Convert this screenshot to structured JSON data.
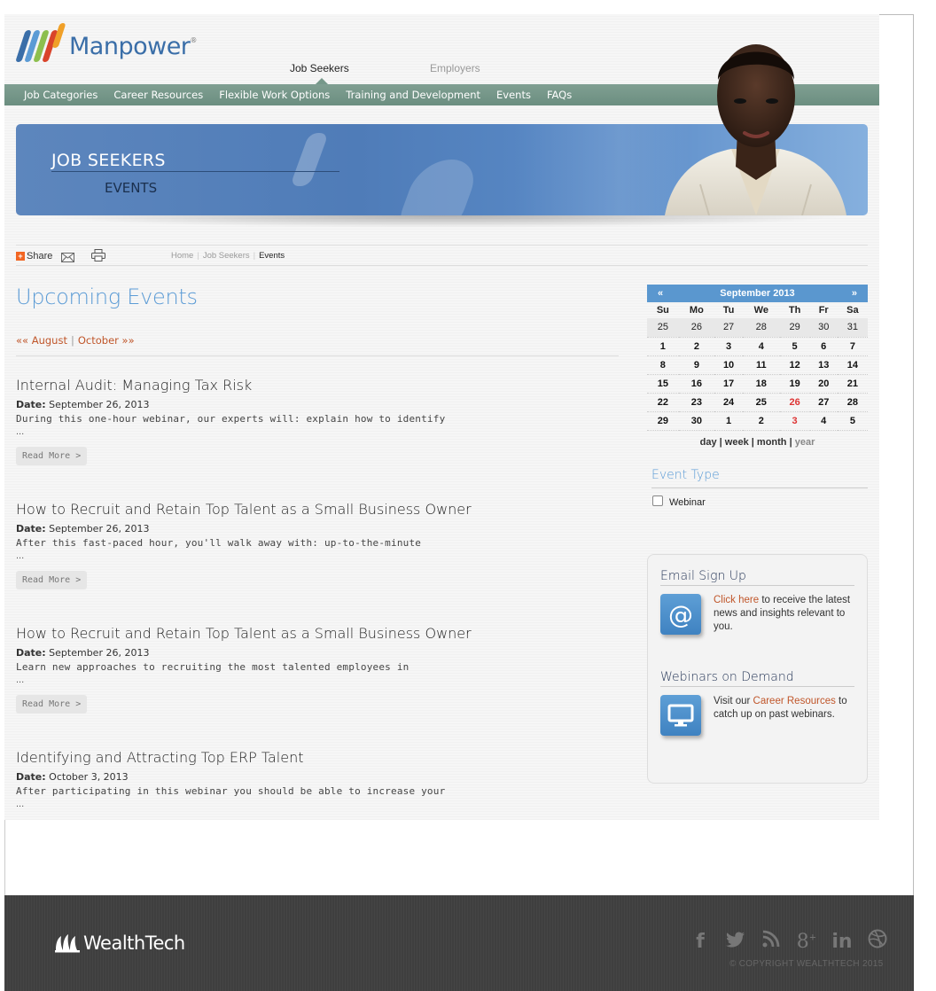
{
  "brand": {
    "name": "Manpower",
    "mark": "®"
  },
  "top_tabs": {
    "active": "Job Seekers",
    "inactive": "Employers"
  },
  "nav": [
    "Job Categories",
    "Career Resources",
    "Flexible Work Options",
    "Training and Development",
    "Events",
    "FAQs"
  ],
  "banner": {
    "title": "JOB SEEKERS",
    "subtitle": "EVENTS"
  },
  "utility": {
    "share": "Share",
    "share_plus": "+"
  },
  "breadcrumb": {
    "home": "Home",
    "section": "Job Seekers",
    "current": "Events",
    "separator": "|"
  },
  "page": {
    "heading": "Upcoming Events",
    "prev_month": "«« August",
    "next_month": "October »»",
    "month_separator": "|"
  },
  "events": [
    {
      "title": "Internal Audit: Managing Tax Risk",
      "date_label": "Date:",
      "date": "September 26, 2013",
      "desc": "During this one-hour webinar, our experts will: explain how to identify",
      "ellipsis": "...",
      "read_more": "Read More >"
    },
    {
      "title": "How to Recruit and Retain Top Talent as a Small Business Owner",
      "date_label": "Date:",
      "date": "September 26, 2013",
      "desc": "After this fast-paced hour, you'll walk away with: up-to-the-minute",
      "ellipsis": "...",
      "read_more": "Read More >"
    },
    {
      "title": "How to Recruit and Retain Top Talent as a Small Business Owner",
      "date_label": "Date:",
      "date": "September 26, 2013",
      "desc": "Learn new approaches to recruiting the most talented employees in",
      "ellipsis": "...",
      "read_more": "Read More >"
    },
    {
      "title": "Identifying and Attracting Top ERP Talent",
      "date_label": "Date:",
      "date": "October 3, 2013",
      "desc": "After participating in this webinar you should be able to increase your",
      "ellipsis": "..."
    }
  ],
  "calendar": {
    "title": "September 2013",
    "prev": "«",
    "next": "»",
    "weekdays": [
      "Su",
      "Mo",
      "Tu",
      "We",
      "Th",
      "Fr",
      "Sa"
    ],
    "weeks": [
      [
        {
          "d": "25",
          "o": true
        },
        {
          "d": "26",
          "o": true
        },
        {
          "d": "27",
          "o": true
        },
        {
          "d": "28",
          "o": true
        },
        {
          "d": "29",
          "o": true
        },
        {
          "d": "30",
          "o": true
        },
        {
          "d": "31",
          "o": true
        }
      ],
      [
        {
          "d": "1"
        },
        {
          "d": "2"
        },
        {
          "d": "3"
        },
        {
          "d": "4"
        },
        {
          "d": "5"
        },
        {
          "d": "6"
        },
        {
          "d": "7"
        }
      ],
      [
        {
          "d": "8"
        },
        {
          "d": "9"
        },
        {
          "d": "10"
        },
        {
          "d": "11"
        },
        {
          "d": "12"
        },
        {
          "d": "13"
        },
        {
          "d": "14"
        }
      ],
      [
        {
          "d": "15"
        },
        {
          "d": "16"
        },
        {
          "d": "17"
        },
        {
          "d": "18"
        },
        {
          "d": "19"
        },
        {
          "d": "20"
        },
        {
          "d": "21"
        }
      ],
      [
        {
          "d": "22"
        },
        {
          "d": "23"
        },
        {
          "d": "24"
        },
        {
          "d": "25"
        },
        {
          "d": "26",
          "r": true
        },
        {
          "d": "27"
        },
        {
          "d": "28"
        }
      ],
      [
        {
          "d": "29"
        },
        {
          "d": "30"
        },
        {
          "d": "1"
        },
        {
          "d": "2"
        },
        {
          "d": "3",
          "r": true
        },
        {
          "d": "4"
        },
        {
          "d": "5"
        }
      ]
    ],
    "views": {
      "day": "day",
      "week": "week",
      "month": "month",
      "year": "year",
      "sep": "|"
    }
  },
  "event_type": {
    "heading": "Event Type",
    "options": [
      "Webinar"
    ],
    "checked": false
  },
  "sidebox": {
    "email_heading": "Email Sign Up",
    "email_link": "Click here",
    "email_text": " to receive the latest news and insights relevant to you.",
    "email_icon": "at-icon",
    "webinar_heading": "Webinars on Demand",
    "webinar_pre": "Visit our ",
    "webinar_link": "Career Resources",
    "webinar_post": " to catch up on past webinars.",
    "webinar_icon": "monitor-icon"
  },
  "footer": {
    "brand": "WealthTech",
    "copyright": "© COPYRIGHT WEALTHTECH 2015",
    "socials": [
      "facebook-icon",
      "twitter-icon",
      "rss-icon",
      "google-plus-icon",
      "linkedin-icon",
      "dribbble-icon"
    ]
  },
  "colors": {
    "nav": "#76988a",
    "accent_blue": "#5b9bd5",
    "link_orange": "#c0562a",
    "calendar_header": "#5a97cf",
    "footer": "#3f3f3f",
    "highlight_red": "#dd3333"
  }
}
